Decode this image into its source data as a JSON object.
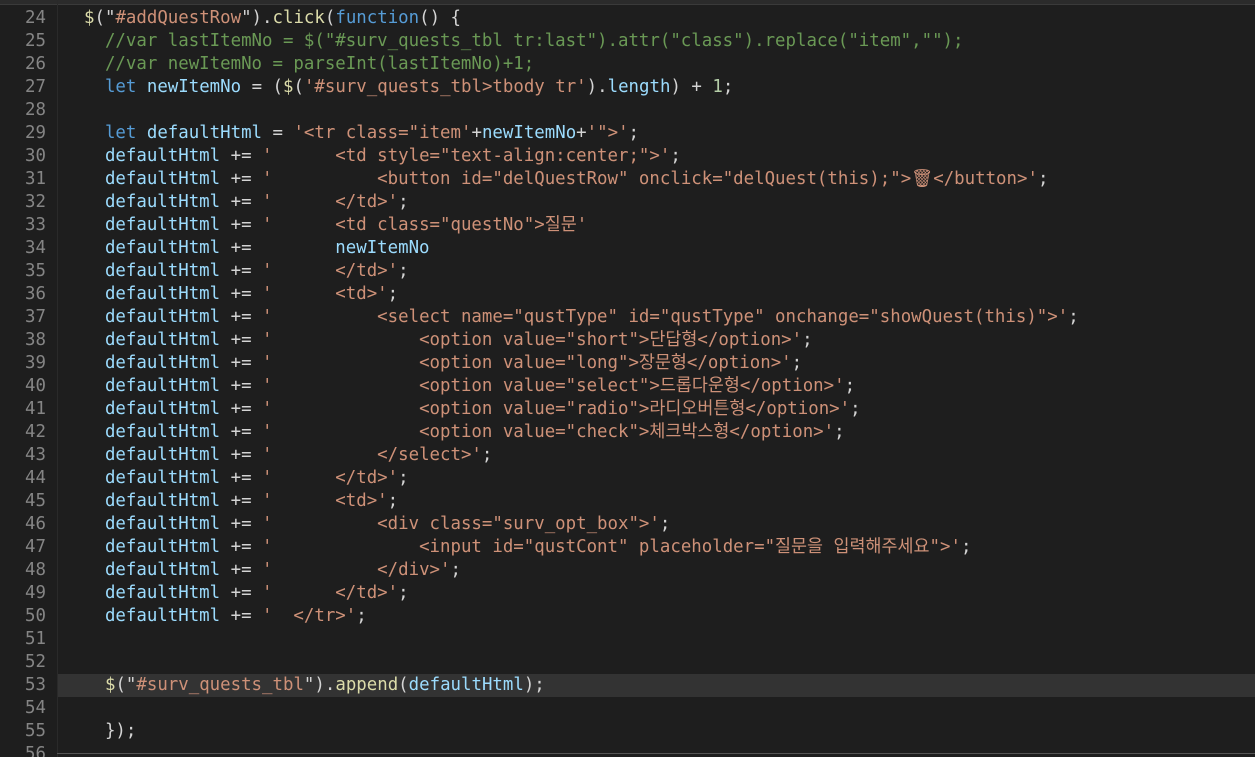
{
  "editor": {
    "language": "javascript",
    "theme_colors": {
      "background": "#1e1e1e",
      "line_number": "#858585",
      "current_line": "#333333",
      "plain": "#d4d4d4",
      "variable": "#9cdcfe",
      "function": "#dcdcaa",
      "string": "#ce9178",
      "keyword": "#569cd6",
      "comment": "#6a9955",
      "number": "#b5cea8"
    },
    "current_line": 53,
    "lines": [
      {
        "n": "24",
        "indent": 0,
        "tokens": [
          [
            "fn",
            "$"
          ],
          [
            "op",
            "(\""
          ],
          [
            "str",
            "#addQuestRow"
          ],
          [
            "op",
            "\")."
          ],
          [
            "fn",
            "click"
          ],
          [
            "op",
            "("
          ],
          [
            "kw",
            "function"
          ],
          [
            "op",
            "() {"
          ]
        ]
      },
      {
        "n": "25",
        "indent": 2,
        "tokens": [
          [
            "cm",
            "//var lastItemNo = $(\"#surv_quests_tbl tr:last\").attr(\"class\").replace(\"item\",\"\");"
          ]
        ]
      },
      {
        "n": "26",
        "indent": 2,
        "tokens": [
          [
            "cm",
            "//var newItemNo = parseInt(lastItemNo)+1;"
          ]
        ]
      },
      {
        "n": "27",
        "indent": 2,
        "tokens": [
          [
            "kw",
            "let"
          ],
          [
            "op",
            " "
          ],
          [
            "var",
            "newItemNo"
          ],
          [
            "op",
            " = ("
          ],
          [
            "fn",
            "$"
          ],
          [
            "op",
            "("
          ],
          [
            "str",
            "'#surv_quests_tbl>tbody tr'"
          ],
          [
            "op",
            ")."
          ],
          [
            "var",
            "length"
          ],
          [
            "op",
            ") + "
          ],
          [
            "num",
            "1"
          ],
          [
            "op",
            ";"
          ]
        ]
      },
      {
        "n": "28",
        "indent": 0,
        "tokens": []
      },
      {
        "n": "29",
        "indent": 2,
        "tokens": [
          [
            "kw",
            "let"
          ],
          [
            "op",
            " "
          ],
          [
            "var",
            "defaultHtml"
          ],
          [
            "op",
            " = "
          ],
          [
            "str",
            "'<tr class=\"item'"
          ],
          [
            "op",
            "+"
          ],
          [
            "var",
            "newItemNo"
          ],
          [
            "op",
            "+"
          ],
          [
            "str",
            "'\">'"
          ],
          [
            "op",
            ";"
          ]
        ]
      },
      {
        "n": "30",
        "indent": 2,
        "tokens": [
          [
            "var",
            "defaultHtml"
          ],
          [
            "op",
            " += "
          ],
          [
            "str",
            "'      <td style=\"text-align:center;\">'"
          ],
          [
            "op",
            ";"
          ]
        ]
      },
      {
        "n": "31",
        "indent": 2,
        "tokens": [
          [
            "var",
            "defaultHtml"
          ],
          [
            "op",
            " += "
          ],
          [
            "str",
            "'          <button id=\"delQuestRow\" onclick=\"delQuest(this);\">🗑</button>'"
          ],
          [
            "op",
            ";"
          ]
        ]
      },
      {
        "n": "32",
        "indent": 2,
        "tokens": [
          [
            "var",
            "defaultHtml"
          ],
          [
            "op",
            " += "
          ],
          [
            "str",
            "'      </td>'"
          ],
          [
            "op",
            ";"
          ]
        ]
      },
      {
        "n": "33",
        "indent": 2,
        "tokens": [
          [
            "var",
            "defaultHtml"
          ],
          [
            "op",
            " += "
          ],
          [
            "str",
            "'      <td class=\"questNo\">질문'"
          ]
        ]
      },
      {
        "n": "34",
        "indent": 2,
        "tokens": [
          [
            "var",
            "defaultHtml"
          ],
          [
            "op",
            " +=        "
          ],
          [
            "var",
            "newItemNo"
          ]
        ]
      },
      {
        "n": "35",
        "indent": 2,
        "tokens": [
          [
            "var",
            "defaultHtml"
          ],
          [
            "op",
            " += "
          ],
          [
            "str",
            "'      </td>'"
          ],
          [
            "op",
            ";"
          ]
        ]
      },
      {
        "n": "36",
        "indent": 2,
        "tokens": [
          [
            "var",
            "defaultHtml"
          ],
          [
            "op",
            " += "
          ],
          [
            "str",
            "'      <td>'"
          ],
          [
            "op",
            ";"
          ]
        ]
      },
      {
        "n": "37",
        "indent": 2,
        "tokens": [
          [
            "var",
            "defaultHtml"
          ],
          [
            "op",
            " += "
          ],
          [
            "str",
            "'          <select name=\"qustType\" id=\"qustType\" onchange=\"showQuest(this)\">'"
          ],
          [
            "op",
            ";"
          ]
        ]
      },
      {
        "n": "38",
        "indent": 2,
        "tokens": [
          [
            "var",
            "defaultHtml"
          ],
          [
            "op",
            " += "
          ],
          [
            "str",
            "'              <option value=\"short\">단답형</option>'"
          ],
          [
            "op",
            ";"
          ]
        ]
      },
      {
        "n": "39",
        "indent": 2,
        "tokens": [
          [
            "var",
            "defaultHtml"
          ],
          [
            "op",
            " += "
          ],
          [
            "str",
            "'              <option value=\"long\">장문형</option>'"
          ],
          [
            "op",
            ";"
          ]
        ]
      },
      {
        "n": "40",
        "indent": 2,
        "tokens": [
          [
            "var",
            "defaultHtml"
          ],
          [
            "op",
            " += "
          ],
          [
            "str",
            "'              <option value=\"select\">드롭다운형</option>'"
          ],
          [
            "op",
            ";"
          ]
        ]
      },
      {
        "n": "41",
        "indent": 2,
        "tokens": [
          [
            "var",
            "defaultHtml"
          ],
          [
            "op",
            " += "
          ],
          [
            "str",
            "'              <option value=\"radio\">라디오버튼형</option>'"
          ],
          [
            "op",
            ";"
          ]
        ]
      },
      {
        "n": "42",
        "indent": 2,
        "tokens": [
          [
            "var",
            "defaultHtml"
          ],
          [
            "op",
            " += "
          ],
          [
            "str",
            "'              <option value=\"check\">체크박스형</option>'"
          ],
          [
            "op",
            ";"
          ]
        ]
      },
      {
        "n": "43",
        "indent": 2,
        "tokens": [
          [
            "var",
            "defaultHtml"
          ],
          [
            "op",
            " += "
          ],
          [
            "str",
            "'          </select>'"
          ],
          [
            "op",
            ";"
          ]
        ]
      },
      {
        "n": "44",
        "indent": 2,
        "tokens": [
          [
            "var",
            "defaultHtml"
          ],
          [
            "op",
            " += "
          ],
          [
            "str",
            "'      </td>'"
          ],
          [
            "op",
            ";"
          ]
        ]
      },
      {
        "n": "45",
        "indent": 2,
        "tokens": [
          [
            "var",
            "defaultHtml"
          ],
          [
            "op",
            " += "
          ],
          [
            "str",
            "'      <td>'"
          ],
          [
            "op",
            ";"
          ]
        ]
      },
      {
        "n": "46",
        "indent": 2,
        "tokens": [
          [
            "var",
            "defaultHtml"
          ],
          [
            "op",
            " += "
          ],
          [
            "str",
            "'          <div class=\"surv_opt_box\">'"
          ],
          [
            "op",
            ";"
          ]
        ]
      },
      {
        "n": "47",
        "indent": 2,
        "tokens": [
          [
            "var",
            "defaultHtml"
          ],
          [
            "op",
            " += "
          ],
          [
            "str",
            "'              <input id=\"qustCont\" placeholder=\"질문을 입력해주세요\">'"
          ],
          [
            "op",
            ";"
          ]
        ]
      },
      {
        "n": "48",
        "indent": 2,
        "tokens": [
          [
            "var",
            "defaultHtml"
          ],
          [
            "op",
            " += "
          ],
          [
            "str",
            "'          </div>'"
          ],
          [
            "op",
            ";"
          ]
        ]
      },
      {
        "n": "49",
        "indent": 2,
        "tokens": [
          [
            "var",
            "defaultHtml"
          ],
          [
            "op",
            " += "
          ],
          [
            "str",
            "'      </td>'"
          ],
          [
            "op",
            ";"
          ]
        ]
      },
      {
        "n": "50",
        "indent": 2,
        "tokens": [
          [
            "var",
            "defaultHtml"
          ],
          [
            "op",
            " += "
          ],
          [
            "str",
            "'  </tr>'"
          ],
          [
            "op",
            ";"
          ]
        ]
      },
      {
        "n": "51",
        "indent": 0,
        "tokens": []
      },
      {
        "n": "52",
        "indent": 0,
        "tokens": []
      },
      {
        "n": "53",
        "indent": 2,
        "tokens": [
          [
            "fn",
            "$"
          ],
          [
            "op",
            "(\""
          ],
          [
            "str",
            "#surv_quests_tbl"
          ],
          [
            "op",
            "\")."
          ],
          [
            "fn",
            "append"
          ],
          [
            "op",
            "("
          ],
          [
            "var",
            "defaultHtml"
          ],
          [
            "op",
            ");"
          ]
        ]
      },
      {
        "n": "54",
        "indent": 0,
        "tokens": []
      },
      {
        "n": "55",
        "indent": 2,
        "tokens": [
          [
            "op",
            "});"
          ]
        ]
      },
      {
        "n": "56",
        "indent": 0,
        "tokens": []
      }
    ]
  }
}
